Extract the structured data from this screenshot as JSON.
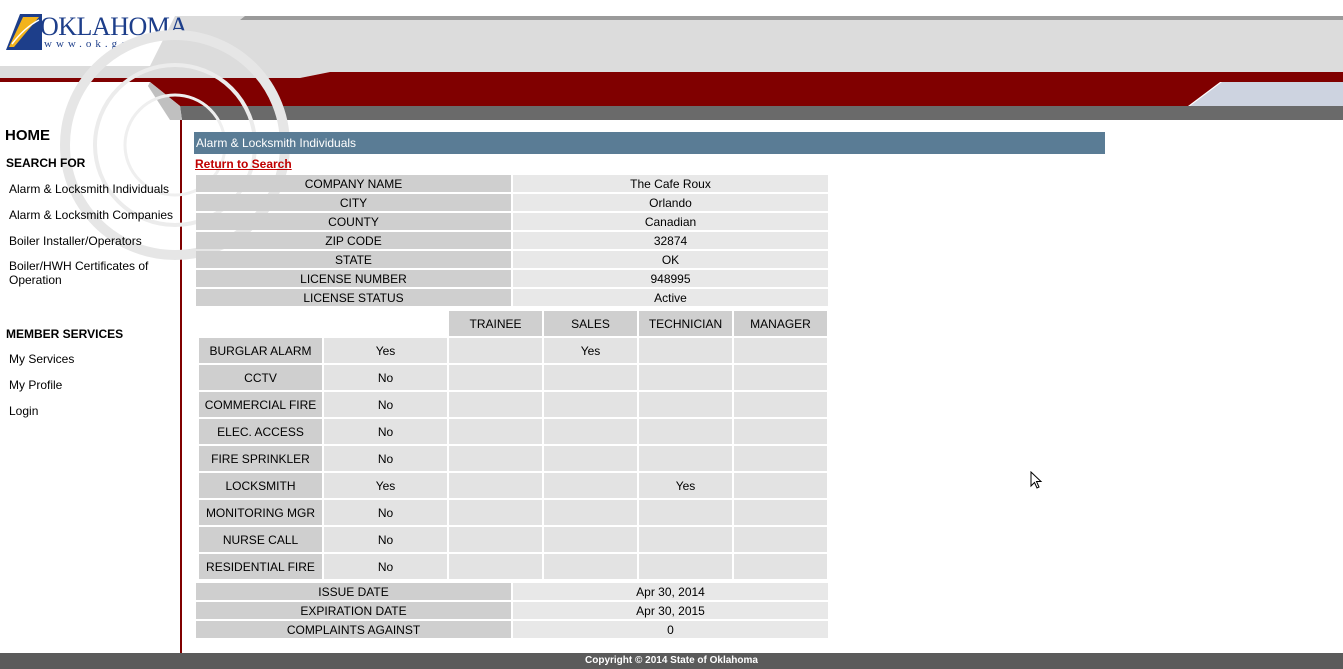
{
  "header": {
    "logo_text": "OKLAHOMA",
    "logo_url": "www.ok.gov"
  },
  "sidebar": {
    "home": "HOME",
    "search_heading": "SEARCH FOR",
    "search_items": [
      "Alarm & Locksmith Individuals",
      "Alarm & Locksmith Companies",
      "Boiler Installer/Operators",
      "Boiler/HWH Certificates of Operation"
    ],
    "member_heading": "MEMBER SERVICES",
    "member_items": [
      "My Services",
      "My Profile",
      "Login"
    ]
  },
  "content": {
    "section_title": "Alarm & Locksmith Individuals",
    "return_link": "Return to Search",
    "info": [
      {
        "label": "COMPANY NAME",
        "value": "The Cafe Roux"
      },
      {
        "label": "CITY",
        "value": "Orlando"
      },
      {
        "label": "COUNTY",
        "value": "Canadian"
      },
      {
        "label": "ZIP CODE",
        "value": "32874"
      },
      {
        "label": "STATE",
        "value": "OK"
      },
      {
        "label": "LICENSE NUMBER",
        "value": "948995"
      },
      {
        "label": "LICENSE STATUS",
        "value": "Active"
      }
    ],
    "category_headers": [
      "TRAINEE",
      "SALES",
      "TECHNICIAN",
      "MANAGER"
    ],
    "categories": [
      {
        "name": "BURGLAR ALARM",
        "held": "Yes",
        "trainee": "",
        "sales": "Yes",
        "technician": "",
        "manager": ""
      },
      {
        "name": "CCTV",
        "held": "No",
        "trainee": "",
        "sales": "",
        "technician": "",
        "manager": ""
      },
      {
        "name": "COMMERCIAL FIRE",
        "held": "No",
        "trainee": "",
        "sales": "",
        "technician": "",
        "manager": ""
      },
      {
        "name": "ELEC. ACCESS",
        "held": "No",
        "trainee": "",
        "sales": "",
        "technician": "",
        "manager": ""
      },
      {
        "name": "FIRE SPRINKLER",
        "held": "No",
        "trainee": "",
        "sales": "",
        "technician": "",
        "manager": ""
      },
      {
        "name": "LOCKSMITH",
        "held": "Yes",
        "trainee": "",
        "sales": "",
        "technician": "Yes",
        "manager": ""
      },
      {
        "name": "MONITORING MGR",
        "held": "No",
        "trainee": "",
        "sales": "",
        "technician": "",
        "manager": ""
      },
      {
        "name": "NURSE CALL",
        "held": "No",
        "trainee": "",
        "sales": "",
        "technician": "",
        "manager": ""
      },
      {
        "name": "RESIDENTIAL FIRE",
        "held": "No",
        "trainee": "",
        "sales": "",
        "technician": "",
        "manager": ""
      }
    ],
    "dates": [
      {
        "label": "ISSUE DATE",
        "value": "Apr 30, 2014"
      },
      {
        "label": "EXPIRATION DATE",
        "value": "Apr 30, 2015"
      },
      {
        "label": "COMPLAINTS AGAINST",
        "value": "0"
      }
    ]
  },
  "footer": {
    "copyright": "Copyright © 2014 State of Oklahoma"
  },
  "colors": {
    "brand_red": "#800000",
    "bar_blue": "#5a7c95",
    "link_red": "#c00000"
  }
}
